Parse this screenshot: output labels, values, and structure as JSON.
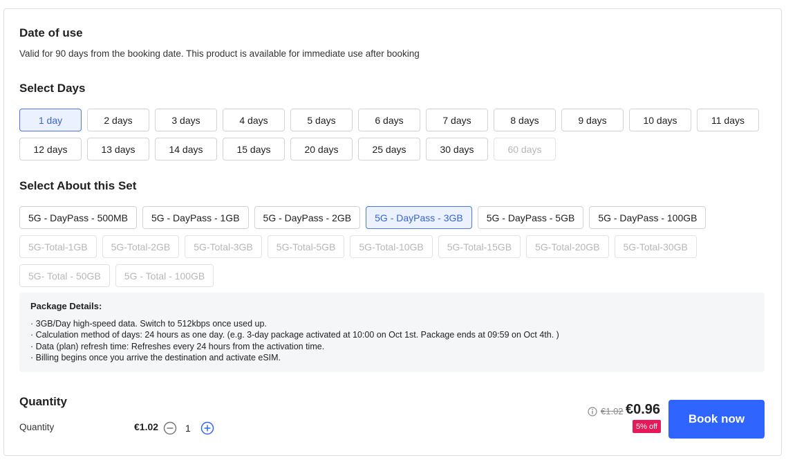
{
  "date_of_use": {
    "title": "Date of use",
    "description": "Valid for 90 days from the booking date. This product is available for immediate use after booking"
  },
  "select_days": {
    "title": "Select Days",
    "row1": [
      "1 day",
      "2 days",
      "3 days",
      "4 days",
      "5 days",
      "6 days",
      "7 days",
      "8 days",
      "9 days",
      "10 days",
      "11 days"
    ],
    "row2": [
      "12 days",
      "13 days",
      "14 days",
      "15 days",
      "20 days",
      "25 days",
      "30 days",
      "60 days"
    ],
    "selected": "1 day",
    "disabled": [
      "60 days"
    ]
  },
  "select_set": {
    "title": "Select About this Set",
    "row1": [
      "5G - DayPass - 500MB",
      "5G - DayPass - 1GB",
      "5G - DayPass - 2GB",
      "5G - DayPass - 3GB",
      "5G - DayPass - 5GB",
      "5G - DayPass - 100GB"
    ],
    "row2": [
      "5G-Total-1GB",
      "5G-Total-2GB",
      "5G-Total-3GB",
      "5G-Total-5GB",
      "5G-Total-10GB",
      "5G-Total-15GB",
      "5G-Total-20GB",
      "5G-Total-30GB"
    ],
    "row3": [
      "5G- Total - 50GB",
      "5G - Total - 100GB"
    ],
    "selected": "5G - DayPass - 3GB",
    "disabled_rows": [
      "row2",
      "row3"
    ]
  },
  "package_details": {
    "title": "Package Details:",
    "lines": [
      "· 3GB/Day high-speed data. Switch to 512kbps once used up.",
      "· Calculation method of days: 24 hours as one day. (e.g. 3-day package activated at 10:00 on Oct 1st. Package ends at 09:59 on Oct 4th. )",
      "· Data (plan) refresh time: Refreshes every 24 hours from the activation time.",
      "· Billing begins once you arrive the destination and activate eSIM."
    ]
  },
  "quantity": {
    "title": "Quantity",
    "label": "Quantity",
    "unit_price": "€1.02",
    "value": "1"
  },
  "price": {
    "original": "€1.02",
    "current": "€0.96",
    "discount": "5% off"
  },
  "book_button": "Book now",
  "colors": {
    "accent": "#2f64ff",
    "selected_bg": "#ebf1ff",
    "selected_border": "#4a78e0",
    "discount_bg": "#e5195a"
  },
  "icons": {
    "minus": "minus-circle-icon",
    "plus": "plus-circle-icon",
    "info": "info-icon"
  }
}
